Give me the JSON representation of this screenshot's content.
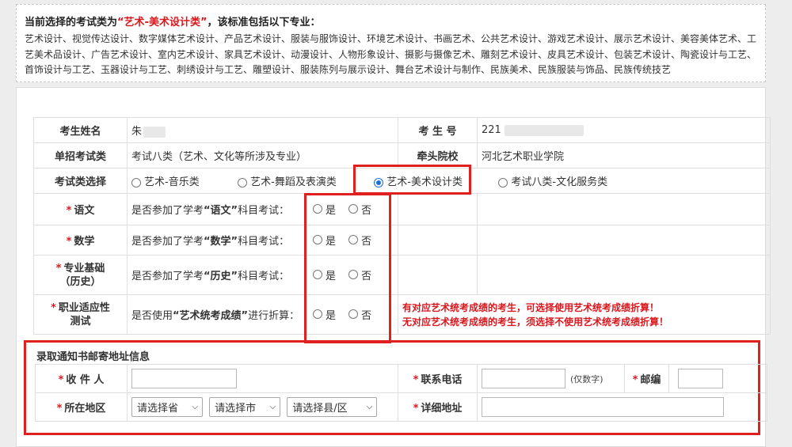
{
  "notice": {
    "prefix": "当前选择的考试类为",
    "category": "“艺术-美术设计类”",
    "suffix": "，该标准包括以下专业：",
    "majors": "艺术设计、视觉传达设计、数字媒体艺术设计、产品艺术设计、服装与服饰设计、环境艺术设计、书画艺术、公共艺术设计、游戏艺术设计、展示艺术设计、美容美体艺术、工艺美术品设计、广告艺术设计、室内艺术设计、家具艺术设计、动漫设计、人物形象设计、摄影与摄像艺术、雕刻艺术设计、皮具艺术设计、包装艺术设计、陶瓷设计与工艺、首饰设计与工艺、玉器设计与工艺、刺绣设计与工艺、雕塑设计、服装陈列与展示设计、舞台艺术设计与制作、民族美术、民族服装与饰品、民族传统技艺"
  },
  "form": {
    "name_label": "考生姓名",
    "name_value": "朱",
    "examno_label": "考 生 号",
    "examno_value": "221",
    "type_label": "单招考试类",
    "type_value": "考试八类（艺术、文化等所涉及专业）",
    "school_label": "牵头院校",
    "school_value": "河北艺术职业学院",
    "choice_label": "考试类选择",
    "choices": [
      "艺术-音乐类",
      "艺术-舞蹈及表演类",
      "艺术-美术设计类",
      "考试八类-文化服务类"
    ],
    "selected_choice": "艺术-美术设计类",
    "yes": "是",
    "no": "否",
    "rows": [
      {
        "label": "语文",
        "q_pre": "是否参加了学考",
        "q_key": "“语文”",
        "q_post": "科目考试："
      },
      {
        "label": "数学",
        "q_pre": "是否参加了学考",
        "q_key": "“数学”",
        "q_post": "科目考试："
      },
      {
        "label1": "专业基础",
        "label2": "（历史）",
        "q_pre": "是否参加了学考",
        "q_key": "“历史”",
        "q_post": "科目考试："
      },
      {
        "label1": "职业适应性",
        "label2": "测试",
        "q_pre": "是否使用",
        "q_key": "“艺术统考成绩”",
        "q_post": "进行折算："
      }
    ],
    "warn1": "有对应艺术统考成绩的考生，可选择使用艺术统考成绩折算！",
    "warn2": "无对应艺术统考成绩的考生，须选择不使用艺术统考成绩折算！"
  },
  "address": {
    "section_title": "录取通知书邮寄地址信息",
    "recipient_label": "收 件 人",
    "phone_label": "联系电话",
    "phone_hint": "(仅数字)",
    "postcode_label": "邮编",
    "region_label": "所在地区",
    "province_placeholder": "请选择省",
    "city_placeholder": "请选择市",
    "county_placeholder": "请选择县/区",
    "detail_label": "详细地址"
  },
  "colors": {
    "accent_red": "#d9181e",
    "radio_blue": "#1a6fd6",
    "highlight_box": "#e0201e"
  }
}
